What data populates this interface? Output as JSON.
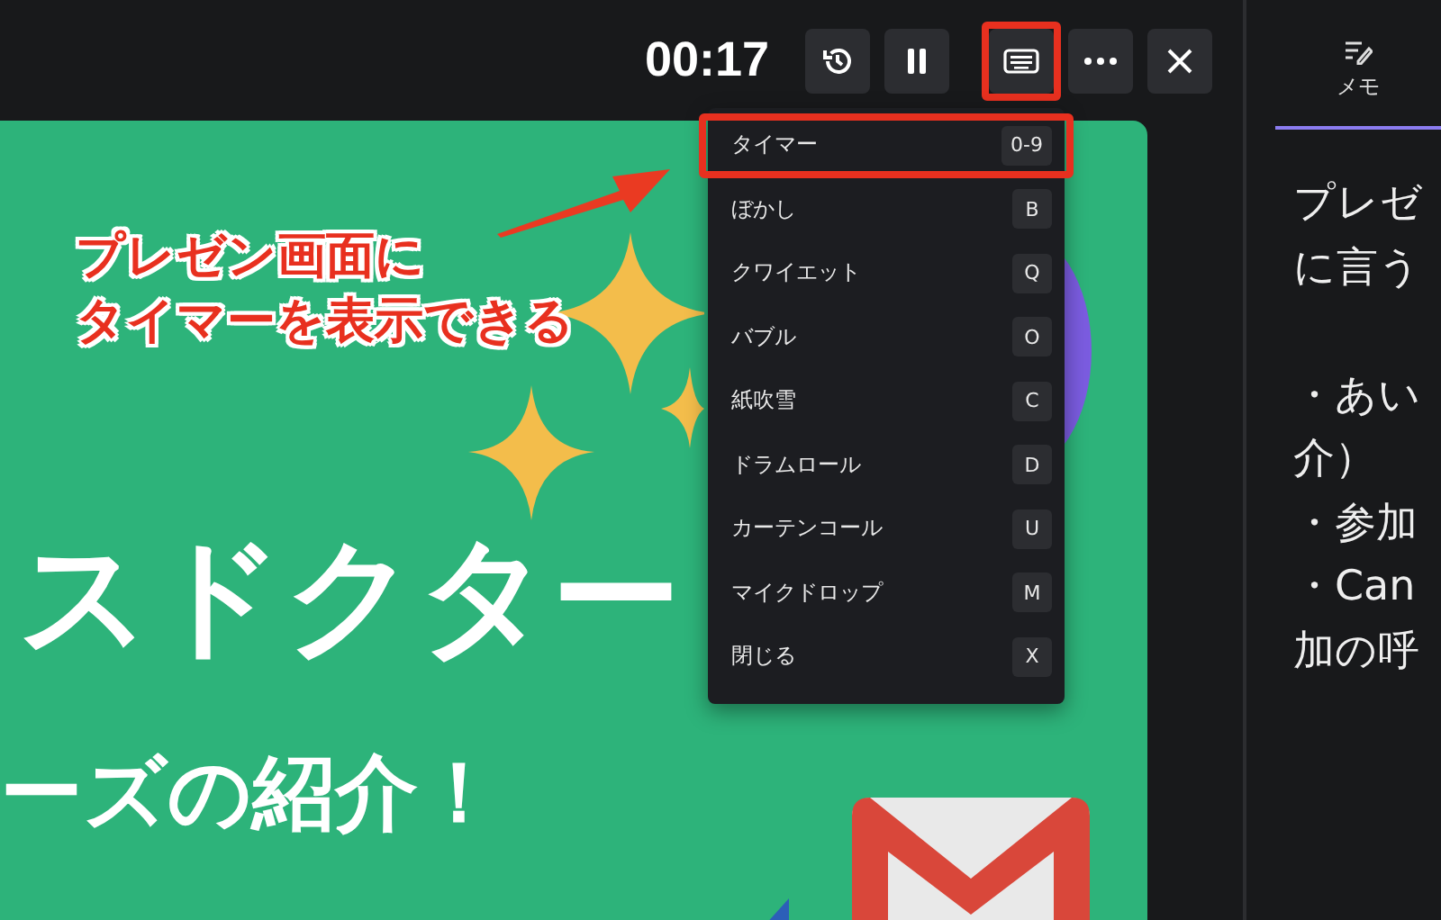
{
  "toolbar": {
    "timer": "00:17",
    "buttons": [
      {
        "kind": "history",
        "highlighted": false
      },
      {
        "kind": "pause",
        "highlighted": false
      },
      {
        "kind": "keyboard",
        "highlighted": true
      },
      {
        "kind": "more",
        "highlighted": false
      },
      {
        "kind": "close",
        "highlighted": false
      }
    ]
  },
  "side_panel": {
    "tab": {
      "label": "メモ",
      "selected": true
    },
    "notes": [
      {
        "text": "プレゼ",
        "new_paragraph": false
      },
      {
        "text": "に言う",
        "new_paragraph": false
      },
      {
        "text": "・あい",
        "new_paragraph": true
      },
      {
        "text": "介）",
        "new_paragraph": false
      },
      {
        "text": "・参加",
        "new_paragraph": false
      },
      {
        "text": "・Can",
        "new_paragraph": false
      },
      {
        "text": "加の呼",
        "new_paragraph": false
      }
    ]
  },
  "slide": {
    "title": "スドクター",
    "subtitle": "ーズの紹介！"
  },
  "shortcut_menu": {
    "items": [
      {
        "label": "タイマー",
        "key": "0-9",
        "highlighted": true
      },
      {
        "label": "ぼかし",
        "key": "B",
        "highlighted": false
      },
      {
        "label": "クワイエット",
        "key": "Q",
        "highlighted": false
      },
      {
        "label": "バブル",
        "key": "O",
        "highlighted": false
      },
      {
        "label": "紙吹雪",
        "key": "C",
        "highlighted": false
      },
      {
        "label": "ドラムロール",
        "key": "D",
        "highlighted": false
      },
      {
        "label": "カーテンコール",
        "key": "U",
        "highlighted": false
      },
      {
        "label": "マイクドロップ",
        "key": "M",
        "highlighted": false
      },
      {
        "label": "閉じる",
        "key": "X",
        "highlighted": false
      }
    ]
  },
  "annotation": {
    "lines": [
      "プレゼン画面に",
      "タイマーを表示できる"
    ]
  }
}
